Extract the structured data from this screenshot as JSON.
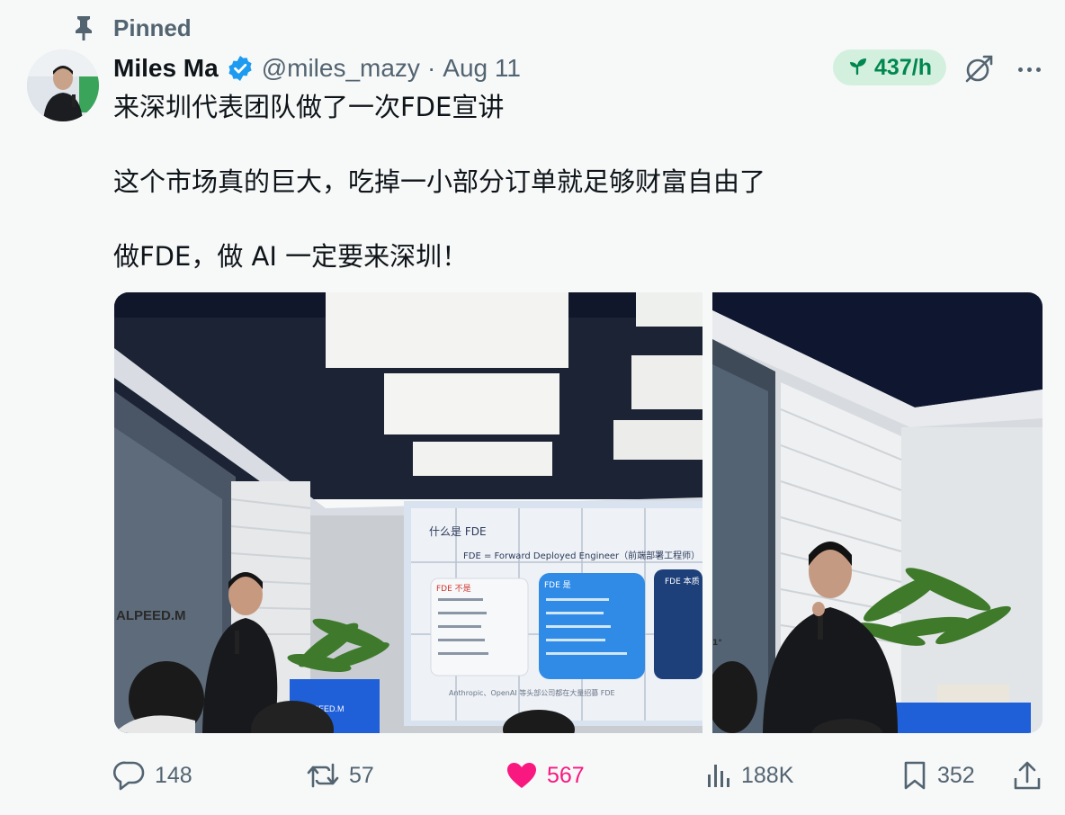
{
  "pinned": {
    "label": "Pinned"
  },
  "author": {
    "display_name": "Miles Ma",
    "handle": "@miles_mazy",
    "separator": "·",
    "date": "Aug 11"
  },
  "rate": {
    "label": "437/h",
    "icon": "sprout-icon",
    "color": "#00874f"
  },
  "tweet": {
    "lines": [
      "来深圳代表团队做了一次FDE宣讲",
      "这个市场真的巨大，吃掉一小部分订单就足够财富自由了",
      "做FDE，做 AI 一定要来深圳！"
    ]
  },
  "slide": {
    "title": "什么是 FDE",
    "subtitle": "FDE = Forward Deployed Engineer（前端部署工程师）",
    "col1_title": "FDE 不是",
    "col2_title": "FDE 是",
    "col3_title": "FDE 本质",
    "footer": "Anthropic、OpenAI 等头部公司都在大量招募 FDE",
    "booth_text": "ALPEED.M"
  },
  "actions": {
    "replies": "148",
    "reposts": "57",
    "likes": "567",
    "views": "188K",
    "bookmarks": "352"
  },
  "colors": {
    "like": "#f91880",
    "verified": "#1d9bf0",
    "muted": "#536471"
  }
}
